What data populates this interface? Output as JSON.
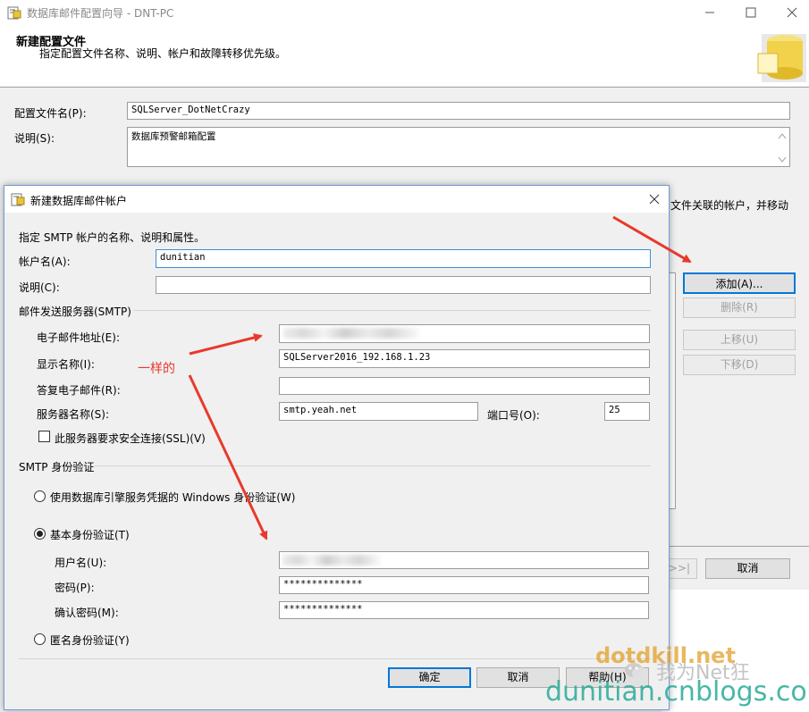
{
  "outer": {
    "title": "数据库邮件配置向导 - DNT-PC",
    "header_title": "新建配置文件",
    "header_subtitle": "指定配置文件名称、说明、帐户和故障转移优先级。",
    "profile_name_label": "配置文件名(P):",
    "profile_name_value": "SQLServer_DotNetCrazy",
    "description_label": "说明(S):",
    "description_value": "数据库预警邮箱配置",
    "accounts_text_fragment": "文件关联的帐户，并移动",
    "add_button": "添加(A)...",
    "remove_button": "删除(R)",
    "move_up_button": "上移(U)",
    "move_down_button": "下移(D)",
    "next_button_fragment": ">>|",
    "cancel_button": "取消"
  },
  "dialog": {
    "title": "新建数据库邮件帐户",
    "intro": "指定 SMTP 帐户的名称、说明和属性。",
    "account_name_label": "帐户名(A):",
    "account_name_value": "dunitian",
    "description_label": "说明(C):",
    "description_value": "",
    "smtp_group": "邮件发送服务器(SMTP)",
    "email_label": "电子邮件地址(E):",
    "display_name_label": "显示名称(I):",
    "display_name_value": "SQLServer2016_192.168.1.23",
    "reply_email_label": "答复电子邮件(R):",
    "reply_email_value": "",
    "server_name_label": "服务器名称(S):",
    "server_name_value": "smtp.yeah.net",
    "port_label": "端口号(O):",
    "port_value": "25",
    "ssl_label": "此服务器要求安全连接(SSL)(V)",
    "ssl_checked": false,
    "auth_group": "SMTP 身份验证",
    "windows_auth_label": "使用数据库引擎服务凭据的 Windows 身份验证(W)",
    "basic_auth_label": "基本身份验证(T)",
    "username_label": "用户名(U):",
    "password_label": "密码(P):",
    "password_value": "**************",
    "confirm_password_label": "确认密码(M):",
    "confirm_password_value": "**************",
    "anonymous_auth_label": "匿名身份验证(Y)",
    "selected_auth": "basic",
    "ok_button": "确定",
    "cancel_button": "取消",
    "help_button": "帮助(H)"
  },
  "annotation": {
    "text": "一样的",
    "color": "#e8392c"
  },
  "watermark": {
    "site1": "dotdkill.net",
    "site2": "我为Net狂",
    "site3": "dunitian.cnblogs.com"
  }
}
